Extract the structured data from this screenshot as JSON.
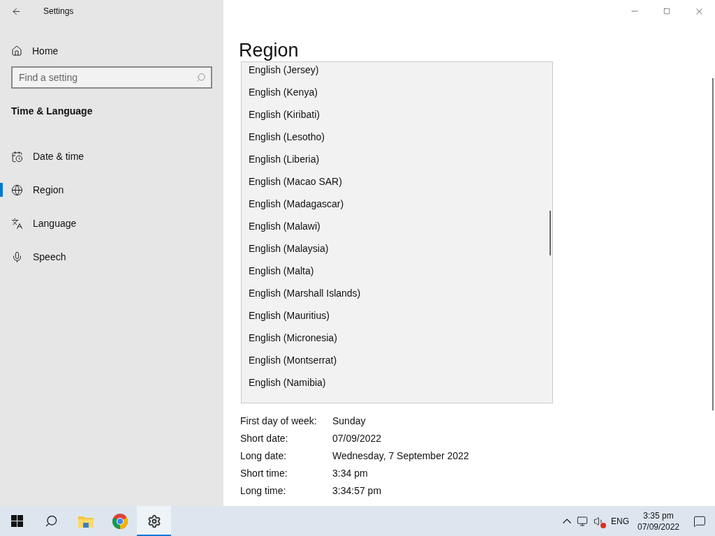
{
  "window": {
    "title": "Settings"
  },
  "sidebar": {
    "home": "Home",
    "search": {
      "placeholder": "Find a setting"
    },
    "section": "Time & Language",
    "items": [
      {
        "label": "Date & time",
        "selected": false
      },
      {
        "label": "Region",
        "selected": true
      },
      {
        "label": "Language",
        "selected": false
      },
      {
        "label": "Speech",
        "selected": false
      }
    ]
  },
  "page": {
    "title": "Region",
    "formats": [
      {
        "label": "First day of week:",
        "value": "Sunday"
      },
      {
        "label": "Short date:",
        "value": "07/09/2022"
      },
      {
        "label": "Long date:",
        "value": "Wednesday, 7 September 2022"
      },
      {
        "label": "Short time:",
        "value": "3:34 pm"
      },
      {
        "label": "Long time:",
        "value": "3:34:57 pm"
      }
    ]
  },
  "dropdown": {
    "options": [
      "English (Jersey)",
      "English (Kenya)",
      "English (Kiribati)",
      "English (Lesotho)",
      "English (Liberia)",
      "English (Macao SAR)",
      "English (Madagascar)",
      "English (Malawi)",
      "English (Malaysia)",
      "English (Malta)",
      "English (Marshall Islands)",
      "English (Mauritius)",
      "English (Micronesia)",
      "English (Montserrat)",
      "English (Namibia)"
    ]
  },
  "taskbar": {
    "apps": [
      {
        "active": false
      },
      {
        "active": false
      },
      {
        "active": false
      },
      {
        "active": false
      },
      {
        "active": true
      }
    ],
    "language": "ENG",
    "time": "3:35 pm",
    "date": "07/09/2022"
  }
}
